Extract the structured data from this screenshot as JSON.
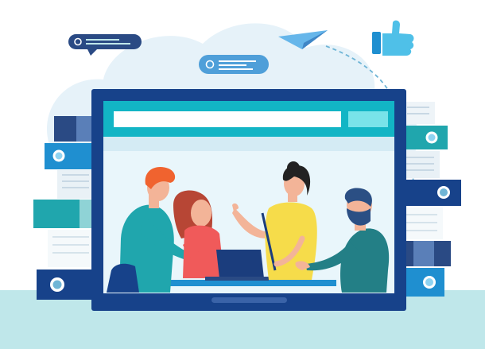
{
  "illustration": {
    "subject": "team-collaboration-around-monitor",
    "icons": [
      "chat-bubble-icon",
      "paper-plane-icon",
      "thumbs-up-icon",
      "binder-icon",
      "laptop-icon"
    ],
    "people_count": 4
  },
  "colors": {
    "cloud": "#e6f2f9",
    "floor": "#bfe7ea",
    "monitor_frame": "#17428a",
    "monitor_screen": "#e9f6fb",
    "browser_bar": "#12b5c5",
    "teal": "#20a6ad",
    "dark_teal": "#237f86",
    "navy": "#17428a",
    "red_shirt": "#f05a5a",
    "yellow_shirt": "#f6dc4a",
    "skin": "#f3b498",
    "orange_hair": "#f0632f",
    "brown_hair": "#b74635",
    "dark_hair": "#222222",
    "beard": "#2b4f84",
    "laptop": "#1b3d7d",
    "dashes": "#6fb5d6"
  }
}
